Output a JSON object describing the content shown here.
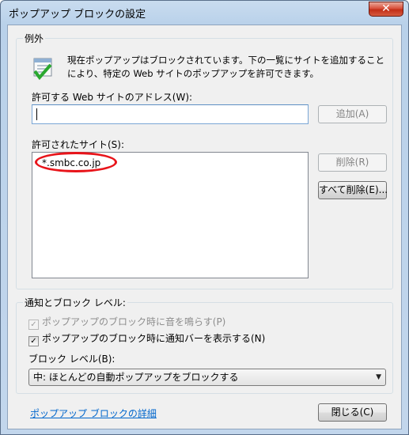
{
  "window": {
    "title": "ポップアップ ブロックの設定",
    "close_glyph": "✕"
  },
  "exceptions": {
    "group_label": "例外",
    "description": "現在ポップアップはブロックされています。下の一覧にサイトを追加することにより、特定の Web サイトのポップアップを許可できます。",
    "address_label": "許可する Web サイトのアドレス(W):",
    "address_value": "",
    "add_button": "追加(A)",
    "allowed_label": "許可されたサイト(S):",
    "allowed_sites": [
      "*.smbc.co.jp"
    ],
    "remove_button": "削除(R)",
    "remove_all_button": "すべて削除(E)..."
  },
  "notifications": {
    "group_label": "通知とブロック レベル:",
    "sound_checkbox": {
      "label": "ポップアップのブロック時に音を鳴らす(P)",
      "checked": true,
      "enabled": false
    },
    "infobar_checkbox": {
      "label": "ポップアップのブロック時に通知バーを表示する(N)",
      "checked": true,
      "enabled": true
    },
    "block_level_label": "ブロック レベル(B):",
    "block_level_value": "中: ほとんどの自動ポップアップをブロックする"
  },
  "footer": {
    "details_link": "ポップアップ ブロックの詳細",
    "close_button": "閉じる(C)"
  },
  "colors": {
    "highlight": "#e8141a",
    "link": "#0066cc"
  }
}
